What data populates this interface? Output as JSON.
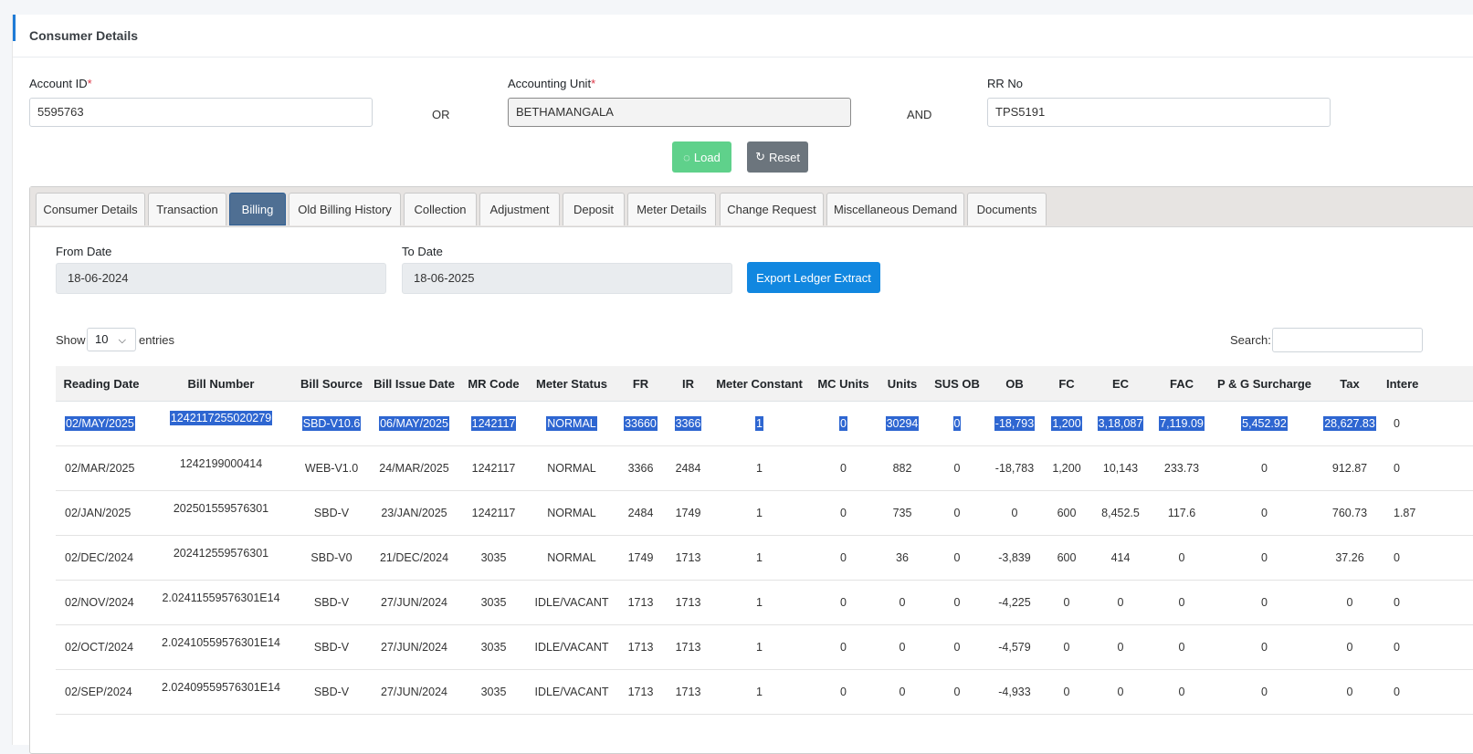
{
  "header": {
    "title": "Consumer Details"
  },
  "form": {
    "account_id_label": "Account ID",
    "account_id_value": "5595763",
    "or_label": "OR",
    "accounting_unit_label": "Accounting Unit",
    "accounting_unit_value": "BETHAMANGALA",
    "and_label": "AND",
    "rr_no_label": "RR No",
    "rr_no_value": "TPS5191",
    "required_mark": "*",
    "load_label": "Load",
    "reset_label": "Reset"
  },
  "tabs": [
    {
      "label": "Consumer Details"
    },
    {
      "label": "Transaction"
    },
    {
      "label": "Billing"
    },
    {
      "label": "Old Billing History"
    },
    {
      "label": "Collection"
    },
    {
      "label": "Adjustment"
    },
    {
      "label": "Deposit"
    },
    {
      "label": "Meter Details"
    },
    {
      "label": "Change Request"
    },
    {
      "label": "Miscellaneous Demand"
    },
    {
      "label": "Documents"
    }
  ],
  "active_tab": "Billing",
  "billing": {
    "from_date_label": "From Date",
    "from_date_value": "18-06-2024",
    "to_date_label": "To Date",
    "to_date_value": "18-06-2025",
    "export_label": "Export Ledger Extract",
    "show_label": "Show",
    "entries_value": "10",
    "entries_label": "entries",
    "search_label": "Search:"
  },
  "table": {
    "columns": [
      "Reading Date",
      "Bill Number",
      "Bill Source",
      "Bill Issue Date",
      "MR Code",
      "Meter Status",
      "FR",
      "IR",
      "Meter Constant",
      "MC Units",
      "Units",
      "SUS OB",
      "OB",
      "FC",
      "EC",
      "FAC",
      "P & G Surcharge",
      "Tax",
      "Intere"
    ],
    "rows": [
      [
        "02/MAY/2025",
        "1242117255020279",
        "SBD-V10.6",
        "06/MAY/2025",
        "1242117",
        "NORMAL",
        "33660",
        "3366",
        "1",
        "0",
        "30294",
        "0",
        "-18,793",
        "1,200",
        "3,18,087",
        "7,119.09",
        "5,452.92",
        "28,627.83",
        "0"
      ],
      [
        "02/MAR/2025",
        "1242199000414",
        "WEB-V1.0",
        "24/MAR/2025",
        "1242117",
        "NORMAL",
        "3366",
        "2484",
        "1",
        "0",
        "882",
        "0",
        "-18,783",
        "1,200",
        "10,143",
        "233.73",
        "0",
        "912.87",
        "0"
      ],
      [
        "02/JAN/2025",
        "202501559576301",
        "SBD-V",
        "23/JAN/2025",
        "1242117",
        "NORMAL",
        "2484",
        "1749",
        "1",
        "0",
        "735",
        "0",
        "0",
        "600",
        "8,452.5",
        "117.6",
        "0",
        "760.73",
        "1.87"
      ],
      [
        "02/DEC/2024",
        "202412559576301",
        "SBD-V0",
        "21/DEC/2024",
        "3035",
        "NORMAL",
        "1749",
        "1713",
        "1",
        "0",
        "36",
        "0",
        "-3,839",
        "600",
        "414",
        "0",
        "0",
        "37.26",
        "0"
      ],
      [
        "02/NOV/2024",
        "2.02411559576301E14",
        "SBD-V",
        "27/JUN/2024",
        "3035",
        "IDLE/VACANT",
        "1713",
        "1713",
        "1",
        "0",
        "0",
        "0",
        "-4,225",
        "0",
        "0",
        "0",
        "0",
        "0",
        "0"
      ],
      [
        "02/OCT/2024",
        "2.02410559576301E14",
        "SBD-V",
        "27/JUN/2024",
        "3035",
        "IDLE/VACANT",
        "1713",
        "1713",
        "1",
        "0",
        "0",
        "0",
        "-4,579",
        "0",
        "0",
        "0",
        "0",
        "0",
        "0"
      ],
      [
        "02/SEP/2024",
        "2.02409559576301E14",
        "SBD-V",
        "27/JUN/2024",
        "3035",
        "IDLE/VACANT",
        "1713",
        "1713",
        "1",
        "0",
        "0",
        "0",
        "-4,933",
        "0",
        "0",
        "0",
        "0",
        "0",
        "0"
      ]
    ]
  }
}
